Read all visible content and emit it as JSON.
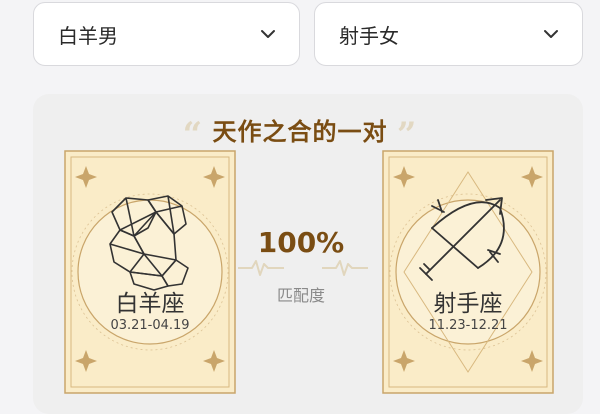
{
  "selectors": {
    "left": {
      "value": "白羊男"
    },
    "right": {
      "value": "射手女"
    }
  },
  "result": {
    "title": "天作之合的一对",
    "quote_open": "“",
    "quote_close": "”",
    "percent": "100%",
    "match_label": "匹配度",
    "match_value": 1.0
  },
  "signs": {
    "left": {
      "name": "白羊座",
      "dates": "03.21-04.19",
      "icon": "aries-ram-icon"
    },
    "right": {
      "name": "射手座",
      "dates": "11.23-12.21",
      "icon": "sagittarius-bow-icon"
    }
  },
  "colors": {
    "brand_brown": "#7a4d13",
    "card_gold": "#c9a56a",
    "card_bg": "#faecc8",
    "panel_bg": "#efefef"
  }
}
